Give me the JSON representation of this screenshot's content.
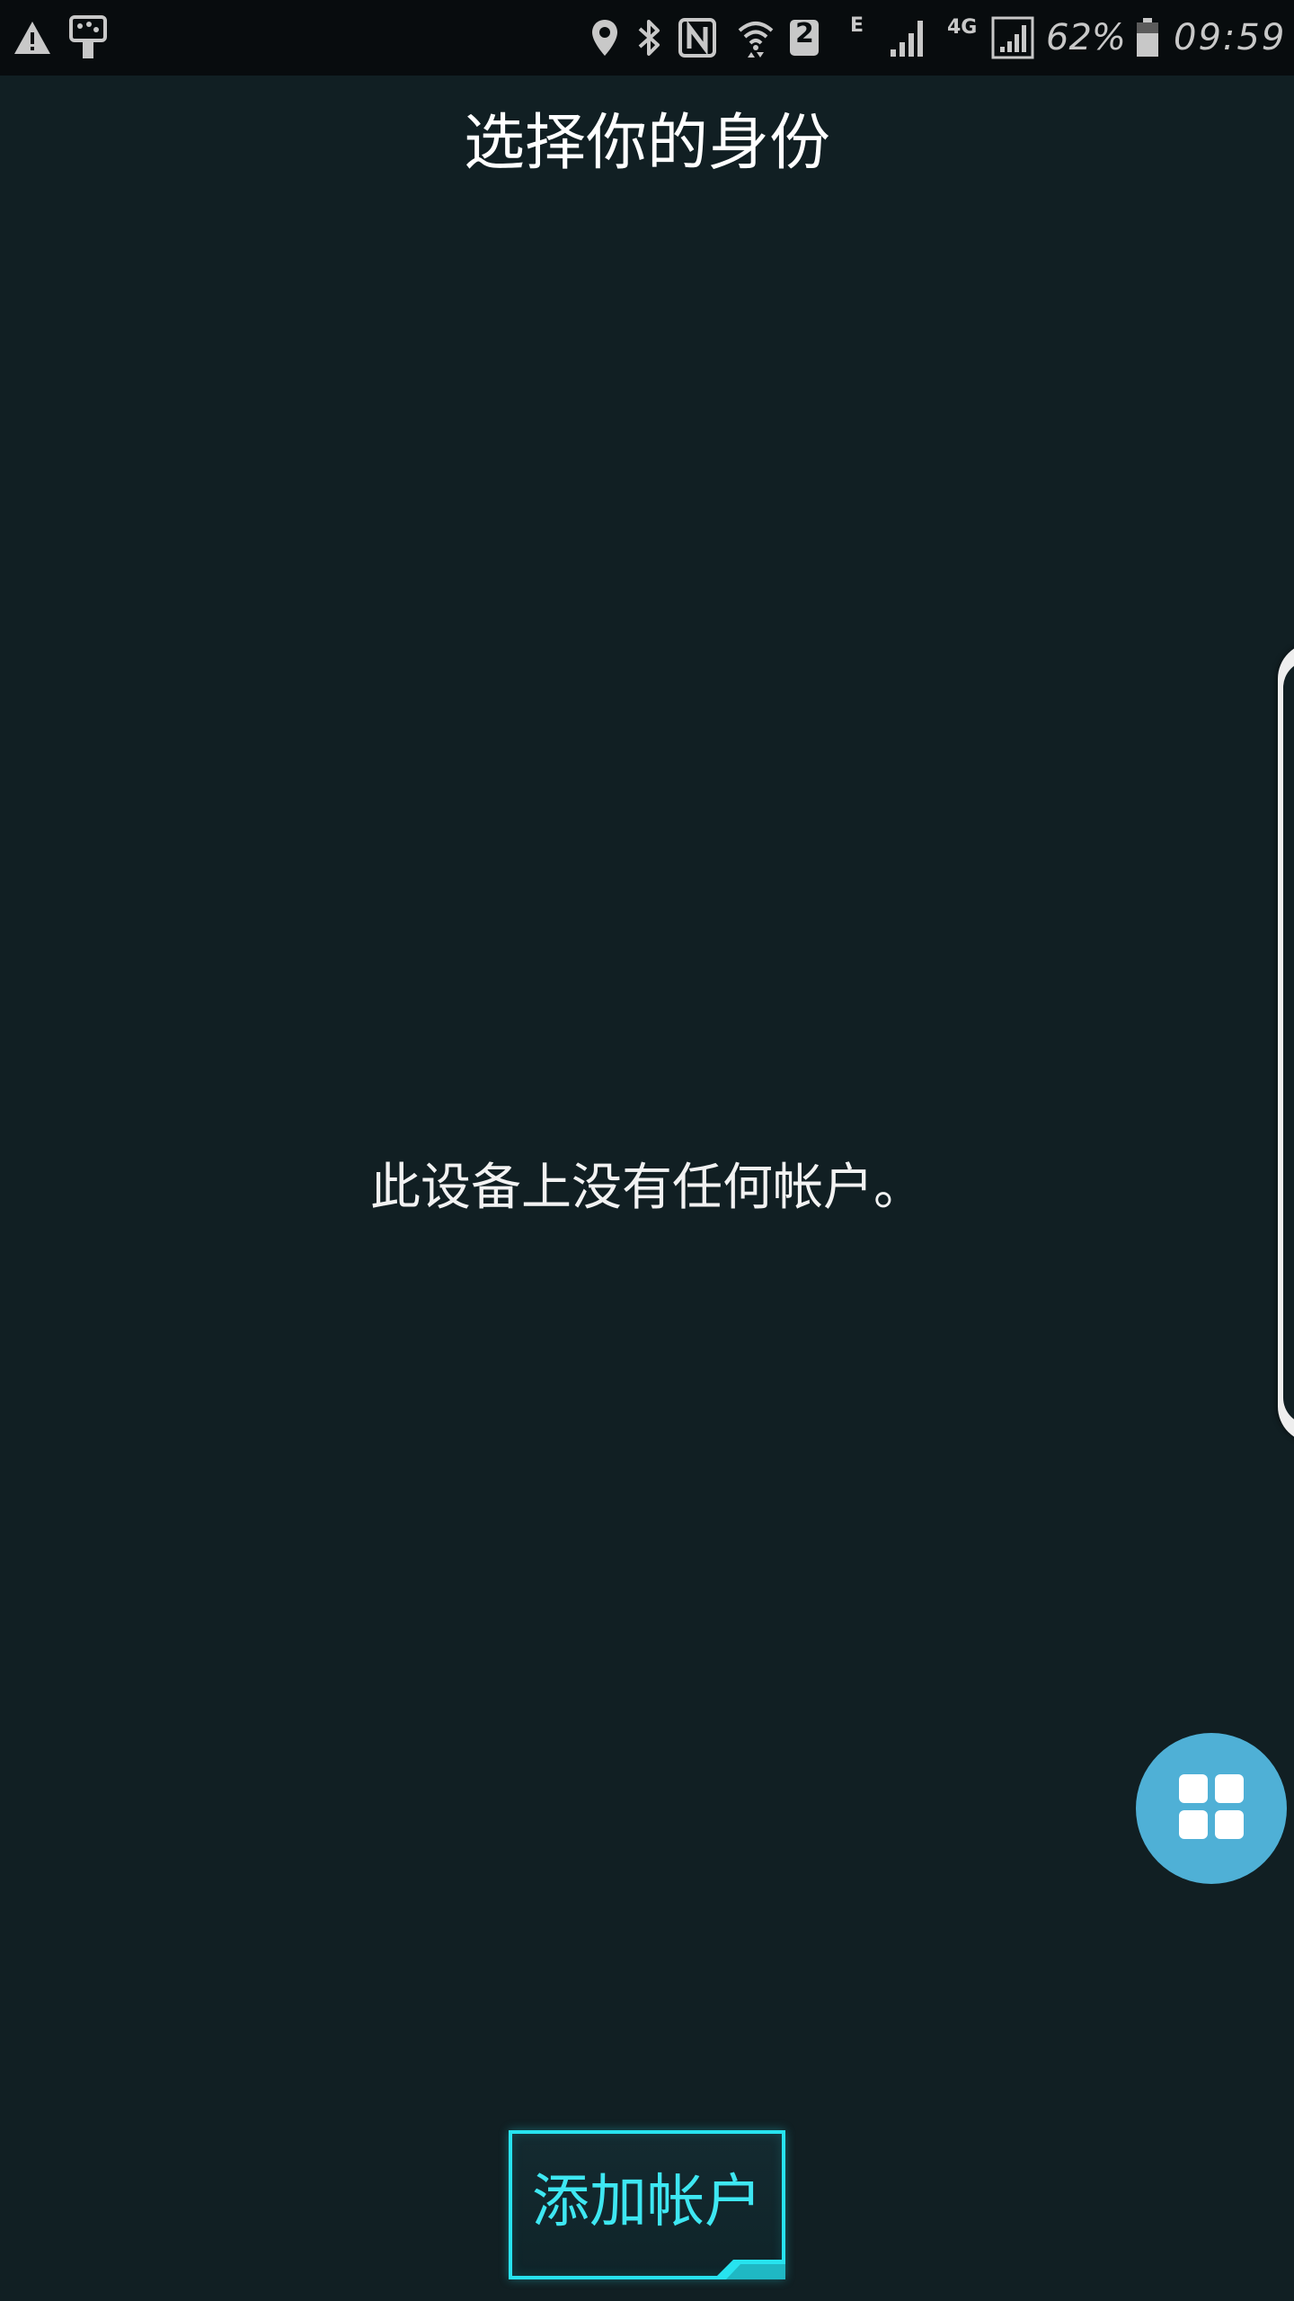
{
  "status_bar": {
    "battery_percent": "62%",
    "time": "09:59",
    "sim_slot": "2",
    "network_e": "E",
    "network_4g": "4G",
    "icons": [
      "warning-icon",
      "usb-icon",
      "location-icon",
      "bluetooth-icon",
      "nfc-icon",
      "wifi-icon",
      "sim-2-icon",
      "signal-icon",
      "signal-4g-icon",
      "battery-icon"
    ]
  },
  "header": {
    "title": "选择你的身份"
  },
  "main": {
    "empty_message": "此设备上没有任何帐户。"
  },
  "actions": {
    "add_account_label": "添加帐户"
  },
  "colors": {
    "background": "#111f23",
    "accent": "#27e3ef",
    "fab": "#4fb0d6"
  }
}
